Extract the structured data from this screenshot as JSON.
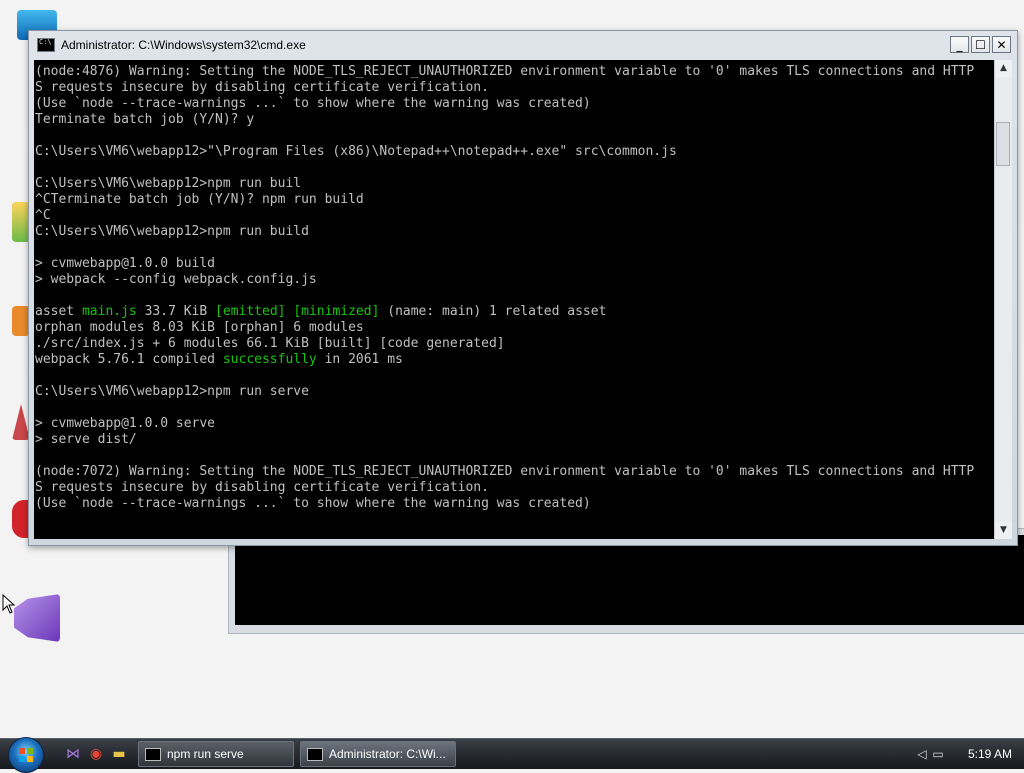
{
  "window": {
    "title": "Administrator:  C:\\Windows\\system32\\cmd.exe",
    "minimize_glyph": "_",
    "maximize_glyph": "☐",
    "close_glyph": "✕"
  },
  "console_lines": [
    [
      {
        "t": "(node:4876) Warning: Setting the NODE_TLS_REJECT_UNAUTHORIZED environment variable to '0' makes TLS connections and HTTP"
      }
    ],
    [
      {
        "t": "S requests insecure by disabling certificate verification."
      }
    ],
    [
      {
        "t": "(Use `node --trace-warnings ...` to show where the warning was created)"
      }
    ],
    [
      {
        "t": "Terminate batch job (Y/N)? y"
      }
    ],
    [
      {
        "t": ""
      }
    ],
    [
      {
        "t": "C:\\Users\\VM6\\webapp12>\"\\Program Files (x86)\\Notepad++\\notepad++.exe\" src\\common.js"
      }
    ],
    [
      {
        "t": ""
      }
    ],
    [
      {
        "t": "C:\\Users\\VM6\\webapp12>npm run buil"
      }
    ],
    [
      {
        "t": "^CTerminate batch job (Y/N)? npm run build"
      }
    ],
    [
      {
        "t": "^C"
      }
    ],
    [
      {
        "t": "C:\\Users\\VM6\\webapp12>npm run build"
      }
    ],
    [
      {
        "t": ""
      }
    ],
    [
      {
        "t": "> cvmwebapp@1.0.0 build"
      }
    ],
    [
      {
        "t": "> webpack --config webpack.config.js"
      }
    ],
    [
      {
        "t": ""
      }
    ],
    [
      {
        "t": "asset "
      },
      {
        "t": "main.js",
        "g": true
      },
      {
        "t": " 33.7 KiB "
      },
      {
        "t": "[emitted] [minimized]",
        "g": true
      },
      {
        "t": " (name: main) 1 related asset"
      }
    ],
    [
      {
        "t": "orphan modules 8.03 KiB [orphan] 6 modules"
      }
    ],
    [
      {
        "t": "./src/index.js + 6 modules 66.1 KiB [built] [code generated]"
      }
    ],
    [
      {
        "t": "webpack 5.76.1 compiled "
      },
      {
        "t": "successfully",
        "g": true
      },
      {
        "t": " in 2061 ms"
      }
    ],
    [
      {
        "t": ""
      }
    ],
    [
      {
        "t": "C:\\Users\\VM6\\webapp12>npm run serve"
      }
    ],
    [
      {
        "t": ""
      }
    ],
    [
      {
        "t": "> cvmwebapp@1.0.0 serve"
      }
    ],
    [
      {
        "t": "> serve dist/"
      }
    ],
    [
      {
        "t": ""
      }
    ],
    [
      {
        "t": "(node:7072) Warning: Setting the NODE_TLS_REJECT_UNAUTHORIZED environment variable to '0' makes TLS connections and HTTP"
      }
    ],
    [
      {
        "t": "S requests insecure by disabling certificate verification."
      }
    ],
    [
      {
        "t": "(Use `node --trace-warnings ...` to show where the warning was created)"
      }
    ]
  ],
  "colors": {
    "console_bg": "#000000",
    "console_fg": "#c0c0c0",
    "console_green": "#16c60c"
  },
  "scrollbar": {
    "up": "▲",
    "down": "▼"
  },
  "taskbar": {
    "quick_launch": [
      {
        "name": "visual-studio-icon",
        "glyph": "⋈"
      },
      {
        "name": "chrome-icon",
        "glyph": "◉"
      },
      {
        "name": "folder-icon",
        "glyph": "▬"
      }
    ],
    "tasks": [
      {
        "label": "npm run serve",
        "active": false
      },
      {
        "label": "Administrator:  C:\\Wi...",
        "active": true
      }
    ],
    "clock": "5:19 AM"
  }
}
